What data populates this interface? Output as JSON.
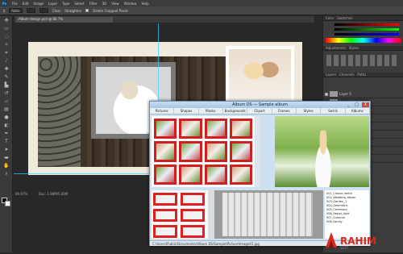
{
  "app": {
    "logo": "Ps",
    "menus": [
      "File",
      "Edit",
      "Image",
      "Layer",
      "Type",
      "Select",
      "Filter",
      "3D",
      "View",
      "Window",
      "Help"
    ]
  },
  "options": {
    "style": "Straighten",
    "mode": "Ratio",
    "clear": "Clear",
    "delete_label": "Delete Cropped Pixels"
  },
  "document": {
    "tab": "Album design.psd @ 66.7%"
  },
  "status": {
    "zoom": "66.67%",
    "doc": "Doc: 1.98M/5.00M"
  },
  "panels": {
    "color_tab": "Color",
    "swatches_tab": "Swatches",
    "adjustments_tab": "Adjustments",
    "styles_tab": "Styles",
    "layers_tab": "Layers",
    "channels_tab": "Channels",
    "paths_tab": "Paths",
    "layers": [
      "Layer 5",
      "Layer 4",
      "Layer 3",
      "Layer 2",
      "Layer 1",
      "Background",
      "Layer 0",
      "Group 1",
      "Shape 1"
    ]
  },
  "album": {
    "title": "Album DS — Sample album",
    "minimize": "_",
    "maximize": "□",
    "close": "X",
    "categories": [
      "Pictures",
      "Shapes",
      "Masks",
      "Backgrounds",
      "Clipart",
      "Frames",
      "Styles",
      "Swirls",
      "Albums"
    ],
    "files": [
      "001_Classic_white",
      "002_Wedding_album",
      "003_Garden_1",
      "004_Geometric",
      "005_Ceremony",
      "006_Pastel_light",
      "007_Summer",
      "008_Family"
    ],
    "statusbar": "C:\\Users\\Public\\Documents\\Album DS\\Sample\\Picture\\Image01.jpg"
  },
  "colors": {
    "accent_red": "#cf1f1f",
    "ps_dark": "#282828",
    "album_title": "#a9c6e6"
  }
}
